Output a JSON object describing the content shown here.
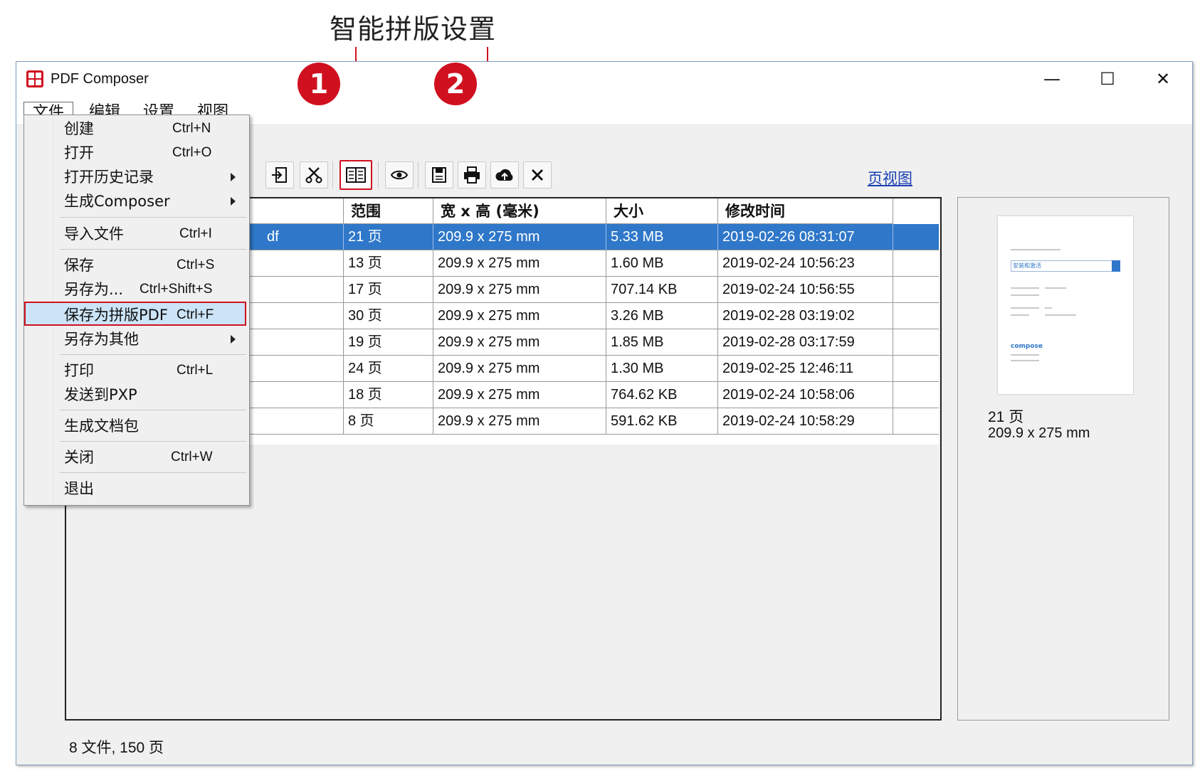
{
  "annotation": {
    "title": "智能拼版设置",
    "badge1": "1",
    "badge2": "2"
  },
  "window": {
    "title": "PDF Composer",
    "controls": {
      "minimize": "—",
      "maximize": "☐",
      "close": "✕"
    }
  },
  "menubar": {
    "items": [
      "文件",
      "编辑",
      "设置",
      "视图"
    ]
  },
  "file_menu": [
    {
      "label": "创建",
      "shortcut": "Ctrl+N"
    },
    {
      "label": "打开",
      "shortcut": "Ctrl+O"
    },
    {
      "label": "打开历史记录",
      "submenu": true
    },
    {
      "label": "生成Composer",
      "submenu": true
    },
    {
      "label": "导入文件",
      "shortcut": "Ctrl+I"
    },
    {
      "label": "保存",
      "shortcut": "Ctrl+S"
    },
    {
      "label": "另存为...",
      "shortcut": "Ctrl+Shift+S"
    },
    {
      "label": "保存为拼版PDF",
      "shortcut": "Ctrl+F",
      "highlighted": true
    },
    {
      "label": "另存为其他",
      "submenu": true
    },
    {
      "label": "打印",
      "shortcut": "Ctrl+L"
    },
    {
      "label": "发送到PXP"
    },
    {
      "label": "生成文档包"
    },
    {
      "label": "关闭",
      "shortcut": "Ctrl+W"
    },
    {
      "label": "退出"
    }
  ],
  "toolbar": {
    "icons": [
      "import-icon",
      "cut-icon",
      "imposition-icon",
      "eye-icon",
      "save-icon",
      "print-icon",
      "upload-icon",
      "delete-icon"
    ],
    "page_view_link": "页视图"
  },
  "table": {
    "headers": [
      "范围",
      "宽 x 高 (毫米)",
      "大小",
      "修改时间"
    ],
    "selected_name_fragment": "df",
    "rows": [
      {
        "range": "21 页",
        "dims": "209.9 x 275 mm",
        "size": "5.33 MB",
        "modified": "2019-02-26 08:31:07"
      },
      {
        "range": "13 页",
        "dims": "209.9 x 275 mm",
        "size": "1.60 MB",
        "modified": "2019-02-24 10:56:23"
      },
      {
        "range": "17 页",
        "dims": "209.9 x 275 mm",
        "size": "707.14 KB",
        "modified": "2019-02-24 10:56:55"
      },
      {
        "range": "30 页",
        "dims": "209.9 x 275 mm",
        "size": "3.26 MB",
        "modified": "2019-02-28 03:19:02"
      },
      {
        "range": "19 页",
        "dims": "209.9 x 275 mm",
        "size": "1.85 MB",
        "modified": "2019-02-28 03:17:59"
      },
      {
        "range": "24 页",
        "dims": "209.9 x 275 mm",
        "size": "1.30 MB",
        "modified": "2019-02-25 12:46:11"
      },
      {
        "range": "18 页",
        "dims": "209.9 x 275 mm",
        "size": "764.62 KB",
        "modified": "2019-02-24 10:58:06"
      },
      {
        "range": "8 页",
        "dims": "209.9 x 275 mm",
        "size": "591.62 KB",
        "modified": "2019-02-24 10:58:29"
      }
    ]
  },
  "preview": {
    "thumb_box_text": "安装和激活",
    "thumb_brand": "compose",
    "pages": "21 页",
    "size": "209.9 x 275 mm"
  },
  "status": {
    "summary": "8 文件, 150 页"
  },
  "colors": {
    "accent_red": "#d0101f",
    "selection_blue": "#2f77c9",
    "menu_highlight": "#cce4f7"
  }
}
